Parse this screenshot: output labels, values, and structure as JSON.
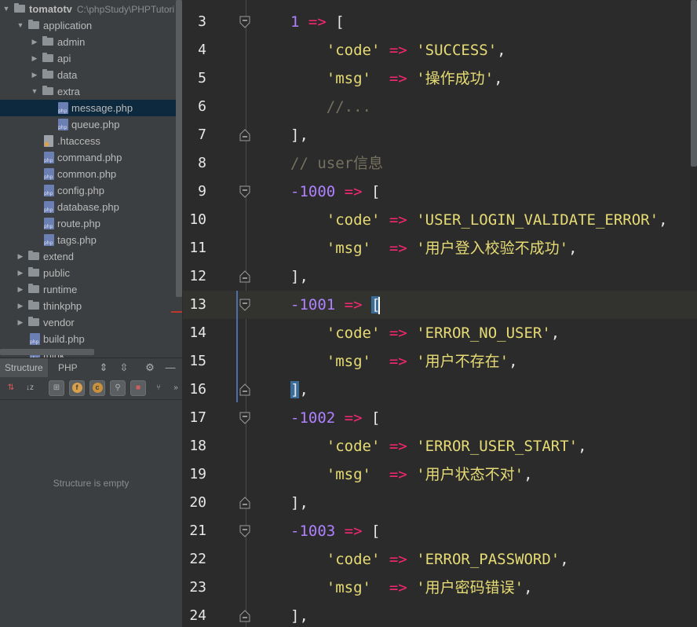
{
  "project_tree": {
    "root": {
      "name": "tomatotv",
      "path": "C:\\phpStudy\\PHPTutori"
    },
    "items": [
      {
        "label": "application",
        "kind": "folder",
        "expanded": true,
        "depth": 1
      },
      {
        "label": "admin",
        "kind": "folder",
        "expanded": false,
        "depth": 2
      },
      {
        "label": "api",
        "kind": "folder",
        "expanded": false,
        "depth": 2
      },
      {
        "label": "data",
        "kind": "folder",
        "expanded": false,
        "depth": 2
      },
      {
        "label": "extra",
        "kind": "folder",
        "expanded": true,
        "depth": 2
      },
      {
        "label": "message.php",
        "kind": "php",
        "depth": 3,
        "selected": true
      },
      {
        "label": "queue.php",
        "kind": "php",
        "depth": 3
      },
      {
        "label": ".htaccess",
        "kind": "htaccess",
        "depth": 2
      },
      {
        "label": "command.php",
        "kind": "php",
        "depth": 2
      },
      {
        "label": "common.php",
        "kind": "php",
        "depth": 2
      },
      {
        "label": "config.php",
        "kind": "php",
        "depth": 2
      },
      {
        "label": "database.php",
        "kind": "php",
        "depth": 2
      },
      {
        "label": "route.php",
        "kind": "php",
        "depth": 2
      },
      {
        "label": "tags.php",
        "kind": "php",
        "depth": 2
      },
      {
        "label": "extend",
        "kind": "folder",
        "expanded": false,
        "depth": 1
      },
      {
        "label": "public",
        "kind": "folder",
        "expanded": false,
        "depth": 1
      },
      {
        "label": "runtime",
        "kind": "folder",
        "expanded": false,
        "depth": 1
      },
      {
        "label": "thinkphp",
        "kind": "folder",
        "expanded": false,
        "depth": 1
      },
      {
        "label": "vendor",
        "kind": "folder",
        "expanded": false,
        "depth": 1
      },
      {
        "label": "build.php",
        "kind": "php",
        "depth": 1
      },
      {
        "label": "think",
        "kind": "php",
        "depth": 1
      }
    ]
  },
  "structure_panel": {
    "tabs": [
      "Structure",
      "PHP"
    ],
    "empty_text": "Structure is empty",
    "toolbar_icons": [
      "sort-by-visibility-icon",
      "sort-alphabetically-icon",
      "show-inherited-icon",
      "show-fields-icon",
      "show-constants-icon",
      "show-properties-icon",
      "show-private-icon",
      "show-includes-icon",
      "more-icon"
    ],
    "toolbar_texts": {
      "alpha": "↓z",
      "more": "»",
      "field": "f",
      "const": "c"
    }
  },
  "editor": {
    "lines": [
      {
        "n": "3",
        "fold": "start",
        "tokens": [
          [
            "num",
            "1"
          ],
          [
            "k",
            " "
          ],
          [
            "arrow-op",
            "=>"
          ],
          [
            "k",
            " "
          ],
          [
            "br",
            "["
          ]
        ]
      },
      {
        "n": "4",
        "tokens": [
          [
            "k",
            "    "
          ],
          [
            "str",
            "'code'"
          ],
          [
            "k",
            " "
          ],
          [
            "arrow-op",
            "=>"
          ],
          [
            "k",
            " "
          ],
          [
            "str",
            "'SUCCESS'"
          ],
          [
            "k",
            ","
          ]
        ]
      },
      {
        "n": "5",
        "tokens": [
          [
            "k",
            "    "
          ],
          [
            "str",
            "'msg'"
          ],
          [
            "k",
            "  "
          ],
          [
            "arrow-op",
            "=>"
          ],
          [
            "k",
            " "
          ],
          [
            "str",
            "'操作成功'"
          ],
          [
            "k",
            ","
          ]
        ]
      },
      {
        "n": "6",
        "tokens": [
          [
            "k",
            "    "
          ],
          [
            "cmt",
            "//..."
          ]
        ]
      },
      {
        "n": "7",
        "fold": "end",
        "tokens": [
          [
            "br",
            "]"
          ],
          [
            "k",
            ","
          ]
        ]
      },
      {
        "n": "8",
        "tokens": [
          [
            "cmt",
            "// user信息"
          ]
        ]
      },
      {
        "n": "9",
        "fold": "start",
        "tokens": [
          [
            "num",
            "-1000"
          ],
          [
            "k",
            " "
          ],
          [
            "arrow-op",
            "=>"
          ],
          [
            "k",
            " "
          ],
          [
            "br",
            "["
          ]
        ]
      },
      {
        "n": "10",
        "tokens": [
          [
            "k",
            "    "
          ],
          [
            "str",
            "'code'"
          ],
          [
            "k",
            " "
          ],
          [
            "arrow-op",
            "=>"
          ],
          [
            "k",
            " "
          ],
          [
            "str",
            "'USER_LOGIN_VALIDATE_ERROR'"
          ],
          [
            "k",
            ","
          ]
        ]
      },
      {
        "n": "11",
        "tokens": [
          [
            "k",
            "    "
          ],
          [
            "str",
            "'msg'"
          ],
          [
            "k",
            "  "
          ],
          [
            "arrow-op",
            "=>"
          ],
          [
            "k",
            " "
          ],
          [
            "str",
            "'用户登入校验不成功'"
          ],
          [
            "k",
            ","
          ]
        ]
      },
      {
        "n": "12",
        "fold": "end",
        "tokens": [
          [
            "br",
            "]"
          ],
          [
            "k",
            ","
          ]
        ]
      },
      {
        "n": "13",
        "fold": "start",
        "current": true,
        "tokens": [
          [
            "num",
            "-1001"
          ],
          [
            "k",
            " "
          ],
          [
            "arrow-op",
            "=>"
          ],
          [
            "k",
            " "
          ],
          [
            "br hl",
            "["
          ],
          [
            "caret",
            ""
          ]
        ]
      },
      {
        "n": "14",
        "tokens": [
          [
            "k",
            "    "
          ],
          [
            "str",
            "'code'"
          ],
          [
            "k",
            " "
          ],
          [
            "arrow-op",
            "=>"
          ],
          [
            "k",
            " "
          ],
          [
            "str",
            "'ERROR_NO_USER'"
          ],
          [
            "k",
            ","
          ]
        ]
      },
      {
        "n": "15",
        "tokens": [
          [
            "k",
            "    "
          ],
          [
            "str",
            "'msg'"
          ],
          [
            "k",
            "  "
          ],
          [
            "arrow-op",
            "=>"
          ],
          [
            "k",
            " "
          ],
          [
            "str",
            "'用户不存在'"
          ],
          [
            "k",
            ","
          ]
        ]
      },
      {
        "n": "16",
        "fold": "end",
        "tokens": [
          [
            "br hl",
            "]"
          ],
          [
            "k",
            ","
          ]
        ]
      },
      {
        "n": "17",
        "fold": "start",
        "tokens": [
          [
            "num",
            "-1002"
          ],
          [
            "k",
            " "
          ],
          [
            "arrow-op",
            "=>"
          ],
          [
            "k",
            " "
          ],
          [
            "br",
            "["
          ]
        ]
      },
      {
        "n": "18",
        "tokens": [
          [
            "k",
            "    "
          ],
          [
            "str",
            "'code'"
          ],
          [
            "k",
            " "
          ],
          [
            "arrow-op",
            "=>"
          ],
          [
            "k",
            " "
          ],
          [
            "str",
            "'ERROR_USER_START'"
          ],
          [
            "k",
            ","
          ]
        ]
      },
      {
        "n": "19",
        "tokens": [
          [
            "k",
            "    "
          ],
          [
            "str",
            "'msg'"
          ],
          [
            "k",
            "  "
          ],
          [
            "arrow-op",
            "=>"
          ],
          [
            "k",
            " "
          ],
          [
            "str",
            "'用户状态不对'"
          ],
          [
            "k",
            ","
          ]
        ]
      },
      {
        "n": "20",
        "fold": "end",
        "tokens": [
          [
            "br",
            "]"
          ],
          [
            "k",
            ","
          ]
        ]
      },
      {
        "n": "21",
        "fold": "start",
        "tokens": [
          [
            "num",
            "-1003"
          ],
          [
            "k",
            " "
          ],
          [
            "arrow-op",
            "=>"
          ],
          [
            "k",
            " "
          ],
          [
            "br",
            "["
          ]
        ]
      },
      {
        "n": "22",
        "tokens": [
          [
            "k",
            "    "
          ],
          [
            "str",
            "'code'"
          ],
          [
            "k",
            " "
          ],
          [
            "arrow-op",
            "=>"
          ],
          [
            "k",
            " "
          ],
          [
            "str",
            "'ERROR_PASSWORD'"
          ],
          [
            "k",
            ","
          ]
        ]
      },
      {
        "n": "23",
        "tokens": [
          [
            "k",
            "    "
          ],
          [
            "str",
            "'msg'"
          ],
          [
            "k",
            "  "
          ],
          [
            "arrow-op",
            "=>"
          ],
          [
            "k",
            " "
          ],
          [
            "str",
            "'用户密码错误'"
          ],
          [
            "k",
            ","
          ]
        ]
      },
      {
        "n": "24",
        "fold": "end",
        "tokens": [
          [
            "br",
            "]"
          ],
          [
            "k",
            ","
          ]
        ]
      }
    ]
  },
  "colors": {
    "editor_bg": "#2b2b2b",
    "sidebar_bg": "#3c3f41",
    "selection": "#0d293e",
    "number": "#ae81ff",
    "operator": "#f92672",
    "string": "#e6db74",
    "comment": "#75715e"
  }
}
